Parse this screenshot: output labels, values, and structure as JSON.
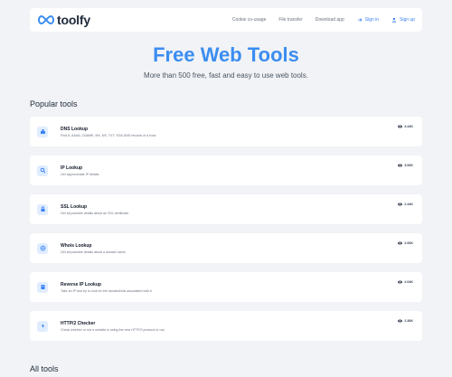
{
  "brand": {
    "name": "toolfy",
    "accent": "#3b8df0"
  },
  "nav": {
    "links": [
      "Cookie co-usage",
      "File transfer",
      "Download app"
    ],
    "sign_in": "Sign in",
    "sign_up": "Sign up"
  },
  "hero": {
    "title": "Free Web Tools",
    "subtitle": "More than 500 free, fast and easy to use web tools."
  },
  "sections": {
    "popular": "Popular tools",
    "all": "All tools"
  },
  "tools": [
    {
      "name": "DNS Lookup",
      "desc": "Find A, AAAA, CNAME, MX, NS, TXT, SOA DNS records of a host.",
      "views": "3.44K",
      "icon": "dns-icon"
    },
    {
      "name": "IP Lookup",
      "desc": "Get approximate IP details.",
      "views": "3.06K",
      "icon": "search-icon"
    },
    {
      "name": "SSL Lookup",
      "desc": "Get all possible details about an SSL certificate.",
      "views": "2.44K",
      "icon": "lock-icon"
    },
    {
      "name": "Whois Lookup",
      "desc": "Get all possible details about a domain name.",
      "views": "2.06K",
      "icon": "globe-icon"
    },
    {
      "name": "Reverse IP Lookup",
      "desc": "Take an IP and try to look for the domain/host associated with it.",
      "views": "2.04K",
      "icon": "server-icon"
    },
    {
      "name": "HTTP/2 Checker",
      "desc": "Check whether or not a website is using the new HTTP/2 protocol or not.",
      "views": "2.36K",
      "icon": "bolt-icon"
    }
  ]
}
